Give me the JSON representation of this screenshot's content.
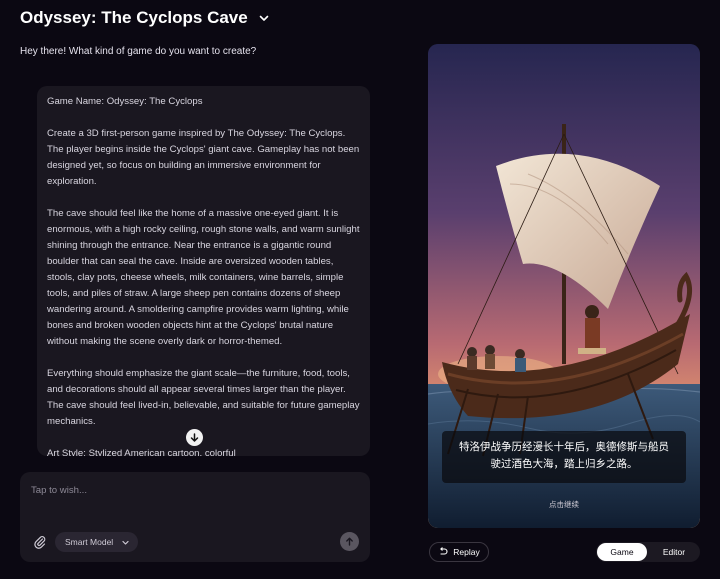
{
  "header": {
    "title": "Odyssey: The Cyclops Cave",
    "dropdown_icon": "chevron-down-icon"
  },
  "chat": {
    "greeting": "Hey there! What kind of game do you want to create?",
    "prompt_paragraphs": [
      "Game Name: Odyssey: The Cyclops",
      "Create a 3D first-person game inspired by The Odyssey: The Cyclops. The player begins inside the Cyclops' giant cave. Gameplay has not been designed yet, so focus on building an immersive environment for exploration.",
      "The cave should feel like the home of a massive one-eyed giant. It is enormous, with a high rocky ceiling, rough stone walls, and warm sunlight shining through the entrance. Near the entrance is a gigantic round boulder that can seal the cave. Inside are oversized wooden tables, stools, clay pots, cheese wheels, milk containers, wine barrels, simple tools, and piles of straw. A large sheep pen contains dozens of sheep wandering around. A smoldering campfire provides warm lighting, while bones and broken wooden objects hint at the Cyclops' brutal nature without making the scene overly dark or horror-themed.",
      "Everything should emphasize the giant scale—the furniture, food, tools, and decorations should all appear several times larger than the player. The cave should feel lived-in, believable, and suitable for future gameplay mechanics.",
      "Art Style: Stylized American cartoon, colorful"
    ],
    "scroll_icon": "arrow-down-icon"
  },
  "composer": {
    "placeholder": "Tap to wish...",
    "value": "",
    "attach_icon": "paperclip-icon",
    "model_label": "Smart Model",
    "send_icon": "arrow-up-icon"
  },
  "game": {
    "dialogue_line1": "特洛伊战争历经漫长十年后，奥德修斯与船员",
    "dialogue_line2": "驶过酒色大海，踏上归乡之路。",
    "continue_hint": "点击继续"
  },
  "footer": {
    "replay_label": "Replay",
    "replay_icon": "undo-icon",
    "mode_game": "Game",
    "mode_editor": "Editor",
    "active_mode": "Game"
  },
  "colors": {
    "background": "#0b0812",
    "card": "#1a1720",
    "sky_top": "#2b2a55",
    "sky_bottom": "#e0876a",
    "sea": "#1d3550"
  }
}
